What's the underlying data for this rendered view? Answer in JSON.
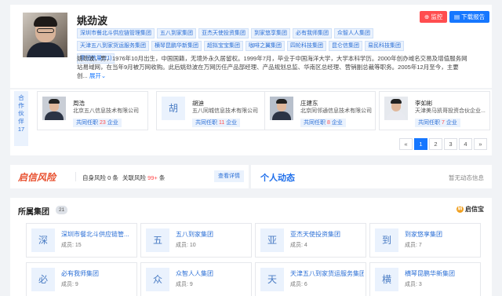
{
  "profile": {
    "name": "姚劲波",
    "monitor_label": "监控",
    "report_label": "下载报告",
    "tags": [
      "深圳市餐北斗供应链管理集团",
      "五八到家集团",
      "亚杰天使投资集团",
      "到家悠享集团",
      "必有我师集团",
      "众智人人集团",
      "天津五八到家货运服务集团",
      "横琴昆鹏华新集团",
      "超拟宝宝集团",
      "咖啡之翼集团",
      "四轮科技集团",
      "昆仑信集团",
      "易民科技集团",
      "集团数量(21)"
    ],
    "bio": "姚劲波，男，1976年10月出生，中国国籍，无境外永久居留权。1999年7月，毕业于中国海洋大学，大学本科学历。2000年创办域名交易及增值服务网站易域网，在当年9月被万网收购。此后姚劲波在万网历任产品部经理、产品规划总监、华南区总经理、营销副总裁等职务。2005年12月至今，主要创...",
    "bio_more": "展开"
  },
  "partners": {
    "tab_label": "合作伙伴",
    "count": "17",
    "items": [
      {
        "name": "周浩",
        "company": "北京五八信息技术有限公司",
        "badge_prefix": "共同任职",
        "badge_num": "23",
        "badge_suffix": "企业",
        "avatar_char": ""
      },
      {
        "name": "胡迪",
        "company": "五八同城信息技术有限公司",
        "badge_prefix": "共同任职",
        "badge_num": "11",
        "badge_suffix": "企业",
        "avatar_char": "胡"
      },
      {
        "name": "庄建东",
        "company": "北京同邻通信息技术有限公司",
        "badge_prefix": "共同任职",
        "badge_num": "8",
        "badge_suffix": "企业",
        "avatar_char": ""
      },
      {
        "name": "李如彬",
        "company": "天津美马凯哥投资合伙企业...",
        "badge_prefix": "共同任职",
        "badge_num": "7",
        "badge_suffix": "企业",
        "avatar_char": ""
      }
    ],
    "pager": {
      "prev": "«",
      "pages": [
        "1",
        "2",
        "3",
        "4"
      ],
      "next": "»",
      "active": "1"
    }
  },
  "risk": {
    "logo": "启信风险",
    "self_label": "自身风险",
    "self_count": "0",
    "self_unit": "条",
    "related_label": "关联风险",
    "related_count": "99+",
    "related_unit": "条",
    "detail_label": "查看详情"
  },
  "dynamics": {
    "title": "个人动态",
    "empty": "暂无动态信息"
  },
  "groups": {
    "title": "所属集团",
    "count": "21",
    "brand": "启信宝",
    "brand_icon": "启",
    "items": [
      {
        "char": "深",
        "name": "深圳市餐北斗供应链管...",
        "members": "成员: 15"
      },
      {
        "char": "五",
        "name": "五八到家集团",
        "members": "成员: 10"
      },
      {
        "char": "亚",
        "name": "亚杰天使投资集团",
        "members": "成员: 4"
      },
      {
        "char": "到",
        "name": "到家悠享集团",
        "members": "成员: 7"
      },
      {
        "char": "必",
        "name": "必有我师集团",
        "members": "成员: 9"
      },
      {
        "char": "众",
        "name": "众智人人集团",
        "members": "成员: 9"
      },
      {
        "char": "天",
        "name": "天津五八到家货运服务集团",
        "members": "成员: 6"
      },
      {
        "char": "横",
        "name": "横琴昆鹏华新集团",
        "members": "成员: 3"
      }
    ]
  },
  "colors": {
    "accent": "#1677ff",
    "danger": "#ff4d4f",
    "tag_bg": "#eaf2fd"
  }
}
